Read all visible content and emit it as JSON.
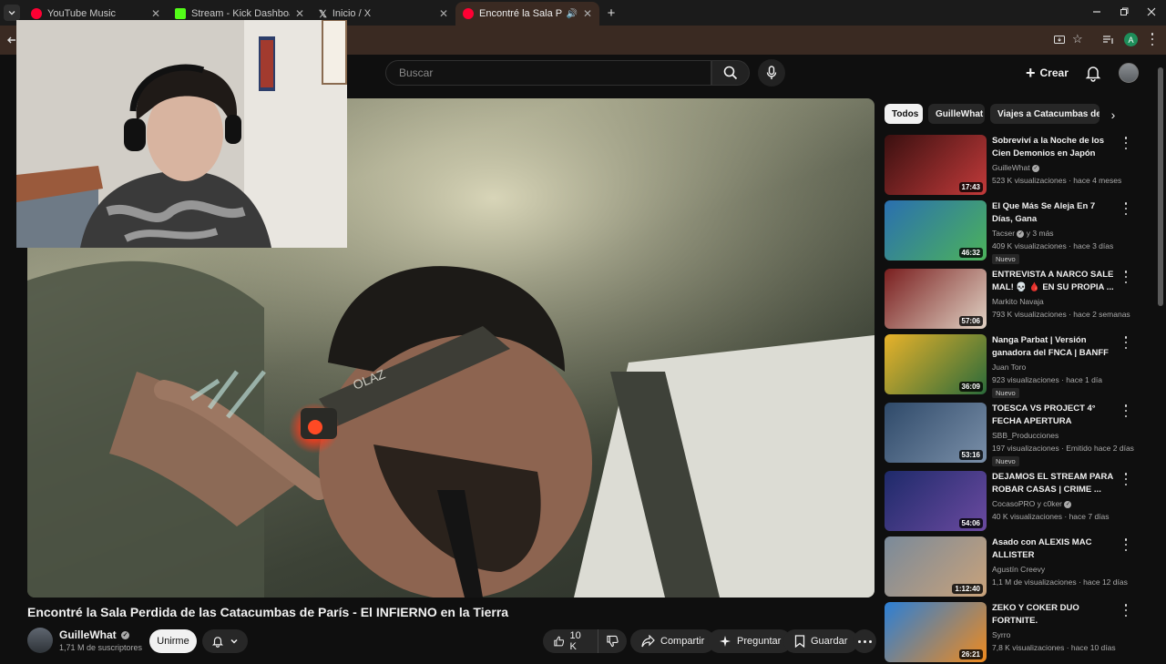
{
  "tabs": [
    {
      "label": "YouTube Music",
      "favicon_color": "#ff0033"
    },
    {
      "label": "Stream - Kick Dashboard",
      "favicon_color": "#53fc18"
    },
    {
      "label": "Inicio / X",
      "favicon_color": "#ffffff"
    },
    {
      "label": "Encontré la Sala Perdida de",
      "favicon_color": "#ff0033"
    }
  ],
  "browser": {
    "profile_initial": "A"
  },
  "header": {
    "search_placeholder": "Buscar",
    "create_label": "Crear"
  },
  "video": {
    "title": "Encontré la Sala Perdida de las Catacumbas de París - El INFIERNO en la Tierra",
    "channel": "GuilleWhat",
    "subscribers": "1,71 M de suscriptores",
    "join_label": "Unirme",
    "likes": "10 K",
    "share_label": "Compartir",
    "ask_label": "Preguntar",
    "save_label": "Guardar",
    "headlamp_text": "OLAZ"
  },
  "chips": [
    "Todos",
    "GuilleWhat",
    "Viajes a Catacumbas de P"
  ],
  "recommendations": [
    {
      "title": "Sobreviví a la Noche de los Cien Demonios en Japón",
      "channel": "GuilleWhat",
      "verified": true,
      "meta": "523 K visualizaciones · hace 4 meses",
      "duration": "17:43",
      "badge": "",
      "thumb_a": "#3a1010",
      "thumb_b": "#c23a3a"
    },
    {
      "title": "El Que Más Se Aleja En 7 Días, Gana",
      "channel": "Tacser",
      "verified": true,
      "channel_extra": "y 3 más",
      "meta": "409 K visualizaciones · hace 3 días",
      "duration": "46:32",
      "badge": "Nuevo",
      "thumb_a": "#2a6fb0",
      "thumb_b": "#4cb35a"
    },
    {
      "title": "ENTREVISTA A NARCO SALE MAL! 💀 🩸 EN SU PROPIA ...",
      "channel": "Markito Navaja",
      "verified": false,
      "meta": "793 K visualizaciones · hace 2 semanas",
      "duration": "57:06",
      "badge": "",
      "thumb_a": "#7a1f1f",
      "thumb_b": "#e0d2c4"
    },
    {
      "title": "Nanga Parbat | Versión ganadora del FNCA | BANFF ...",
      "channel": "Juan Toro",
      "verified": false,
      "meta": "923 visualizaciones · hace 1 día",
      "duration": "36:09",
      "badge": "Nuevo",
      "thumb_a": "#e8b22a",
      "thumb_b": "#2a6a3a"
    },
    {
      "title": "TOESCA VS PROJECT 4° FECHA APERTURA",
      "channel": "SBB_Producciones",
      "verified": false,
      "meta": "197 visualizaciones · Emitido hace 2 días",
      "duration": "53:16",
      "badge": "Nuevo",
      "thumb_a": "#2f4a6a",
      "thumb_b": "#7a8fa8"
    },
    {
      "title": "DEJAMOS EL STREAM PARA ROBAR CASAS | CRIME ...",
      "channel": "CocasoPRO y c0ker",
      "verified": true,
      "meta": "40 K visualizaciones · hace 7 días",
      "duration": "54:06",
      "badge": "",
      "thumb_a": "#1e2a6a",
      "thumb_b": "#6b4aa0"
    },
    {
      "title": "Asado con ALEXIS MAC ALLISTER",
      "channel": "Agustín Creevy",
      "verified": false,
      "meta": "1,1 M de visualizaciones · hace 12 días",
      "duration": "1:12:40",
      "badge": "",
      "thumb_a": "#7a8a9a",
      "thumb_b": "#c9a27a"
    },
    {
      "title": "ZEKO Y COKER DUO FORTNITE.",
      "channel": "Syrro",
      "verified": false,
      "meta": "7,8 K visualizaciones · hace 10 días",
      "duration": "26:21",
      "badge": "",
      "thumb_a": "#2b7fd6",
      "thumb_b": "#ef8a1e"
    }
  ]
}
